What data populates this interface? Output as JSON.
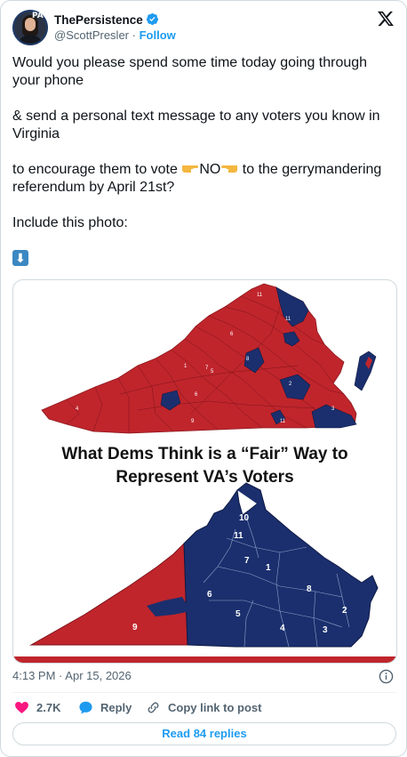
{
  "author": {
    "display_name": "ThePersistence",
    "handle": "@ScottPresler",
    "separator": "·",
    "follow_label": "Follow",
    "avatar_badge": "PA"
  },
  "icons": {
    "verified": "verified-badge-icon",
    "x_logo": "x-logo-icon",
    "info": "info-icon",
    "like": "heart-icon",
    "reply": "speech-bubble-icon",
    "copy": "link-icon"
  },
  "tweet": {
    "line1": "Would you please spend some time today going through your phone",
    "line2": "& send a personal text message to any voters you know in Virginia",
    "line3_before": "to encourage them to vote ",
    "line3_no": "NO",
    "line3_after": " to the gerrymandering referendum by April 21st?",
    "line4": "Include this photo:",
    "down_arrow": "⬇"
  },
  "image": {
    "title_line1": "What Dems Think is a “Fair” Way to",
    "title_line2": "Represent VA’s Voters",
    "top_map_labels": [
      "11",
      "11",
      "6",
      "8",
      "1",
      "7",
      "5",
      "6",
      "2",
      "4",
      "3",
      "11",
      "9"
    ],
    "bottom_map_labels": [
      "10",
      "11",
      "7",
      "1",
      "6",
      "8",
      "2",
      "5",
      "4",
      "3",
      "9"
    ]
  },
  "meta": {
    "time": "4:13 PM",
    "separator": "·",
    "date": "Apr 15, 2026"
  },
  "actions": {
    "likes": "2.7K",
    "reply_label": "Reply",
    "copy_label": "Copy link to post"
  },
  "read_replies": "Read 84 replies",
  "colors": {
    "accent": "#1d9bf0",
    "like": "#f91880",
    "map_red": "#c0252c",
    "map_blue": "#1b2f6e"
  }
}
